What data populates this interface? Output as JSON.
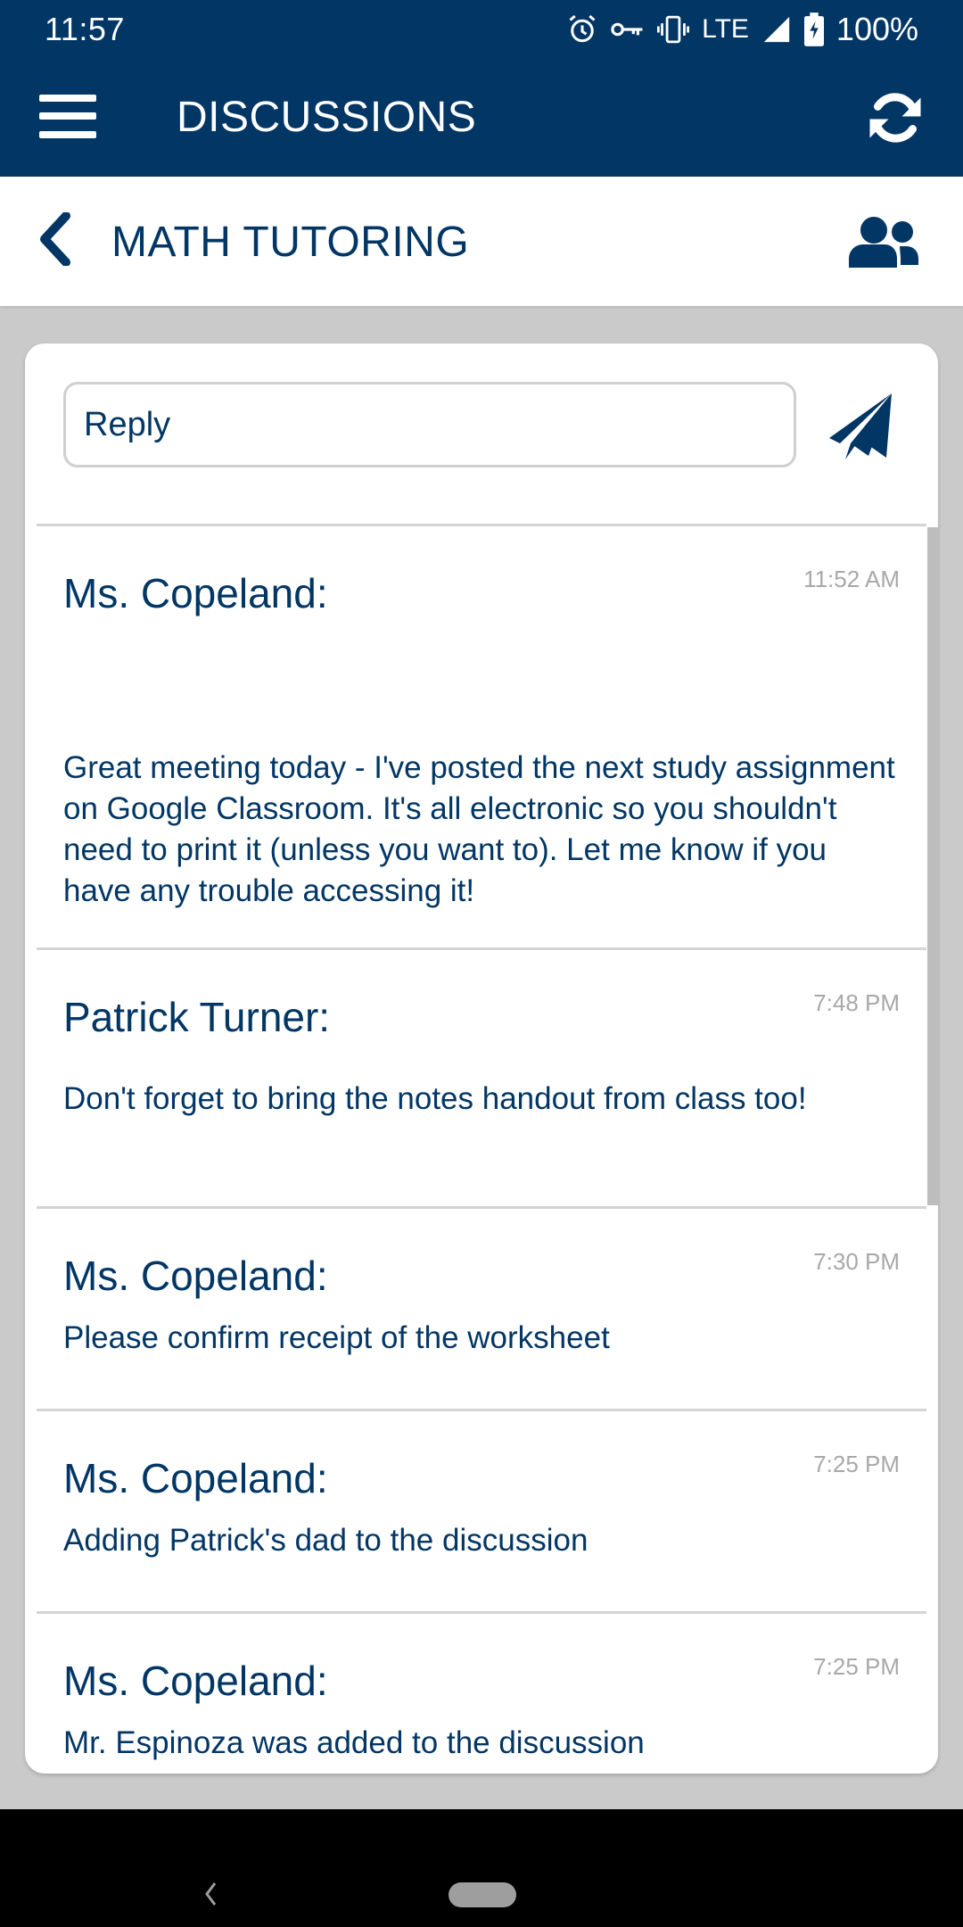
{
  "status_bar": {
    "time": "11:57",
    "icons": [
      "alarm-icon",
      "vpn-key-icon",
      "vibrate-icon",
      "lte-icon",
      "signal-icon",
      "battery-charging-icon"
    ],
    "network": "LTE",
    "battery": "100%"
  },
  "app_bar": {
    "menu_icon": "hamburger-menu-icon",
    "title": "DISCUSSIONS",
    "refresh_icon": "refresh-icon"
  },
  "sub_header": {
    "back_icon": "chevron-left-icon",
    "title": "MATH TUTORING",
    "members_icon": "users-icon"
  },
  "reply": {
    "placeholder": "Reply",
    "value": "",
    "send_icon": "paper-plane-icon"
  },
  "messages": [
    {
      "sender": "Ms. Copeland:",
      "time": "11:52 AM",
      "body": "Great meeting today - I've posted the next study assignment on Google Classroom. It's all electronic so you shouldn't need to print it (unless you want to). Let me know if you have any trouble accessing it!"
    },
    {
      "sender": "Patrick Turner:",
      "time": "7:48 PM",
      "body": "Don't forget to bring the notes handout from class too!"
    },
    {
      "sender": "Ms. Copeland:",
      "time": "7:30 PM",
      "body": "Please confirm receipt of the worksheet"
    },
    {
      "sender": "Ms. Copeland:",
      "time": "7:25 PM",
      "body": "Adding Patrick's dad to the discussion"
    },
    {
      "sender": "Ms. Copeland:",
      "time": "7:25 PM",
      "body": "Mr. Espinoza was added to the discussion"
    }
  ],
  "colors": {
    "brand": "#023665",
    "background": "#cacaca",
    "timestamp": "#a8a8a8",
    "divider": "#d4d4d4"
  }
}
